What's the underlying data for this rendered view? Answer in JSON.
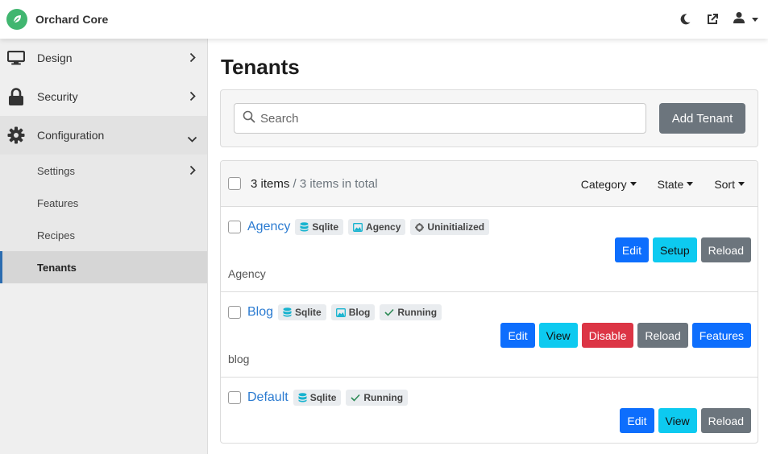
{
  "app": {
    "title": "Orchard Core",
    "colors": {
      "brand": "#41b670",
      "primary": "#0d6efd",
      "info": "#0dcaf0",
      "secondary": "#6c757d",
      "danger": "#dc3545"
    }
  },
  "topbar": {
    "icons": [
      "moon-icon",
      "external-link-icon",
      "user-icon",
      "caret-down-icon"
    ]
  },
  "sidebar": {
    "items": [
      {
        "label": "Design",
        "icon": "monitor-icon",
        "expanded": false
      },
      {
        "label": "Security",
        "icon": "lock-icon",
        "expanded": false
      },
      {
        "label": "Configuration",
        "icon": "gear-icon",
        "expanded": true
      }
    ],
    "subitems": [
      {
        "label": "Settings",
        "has_children": true
      },
      {
        "label": "Features"
      },
      {
        "label": "Recipes"
      },
      {
        "label": "Tenants",
        "active": true
      }
    ]
  },
  "page": {
    "title": "Tenants",
    "search_placeholder": "Search",
    "add_button": "Add Tenant"
  },
  "list": {
    "count": "3 items",
    "total": "/ 3 items in total",
    "filters": {
      "category": "Category",
      "state": "State",
      "sort": "Sort"
    },
    "tenants": [
      {
        "name": "Agency",
        "badges": {
          "db": "Sqlite",
          "recipe": "Agency",
          "state": "Uninitialized"
        },
        "actions": [
          "Edit",
          "Setup",
          "Reload"
        ],
        "description": "Agency"
      },
      {
        "name": "Blog",
        "badges": {
          "db": "Sqlite",
          "recipe": "Blog",
          "state": "Running"
        },
        "actions": [
          "Edit",
          "View",
          "Disable",
          "Reload",
          "Features"
        ],
        "description": "blog"
      },
      {
        "name": "Default",
        "badges": {
          "db": "Sqlite",
          "state": "Running"
        },
        "actions": [
          "Edit",
          "View",
          "Reload"
        ],
        "description": ""
      }
    ]
  }
}
